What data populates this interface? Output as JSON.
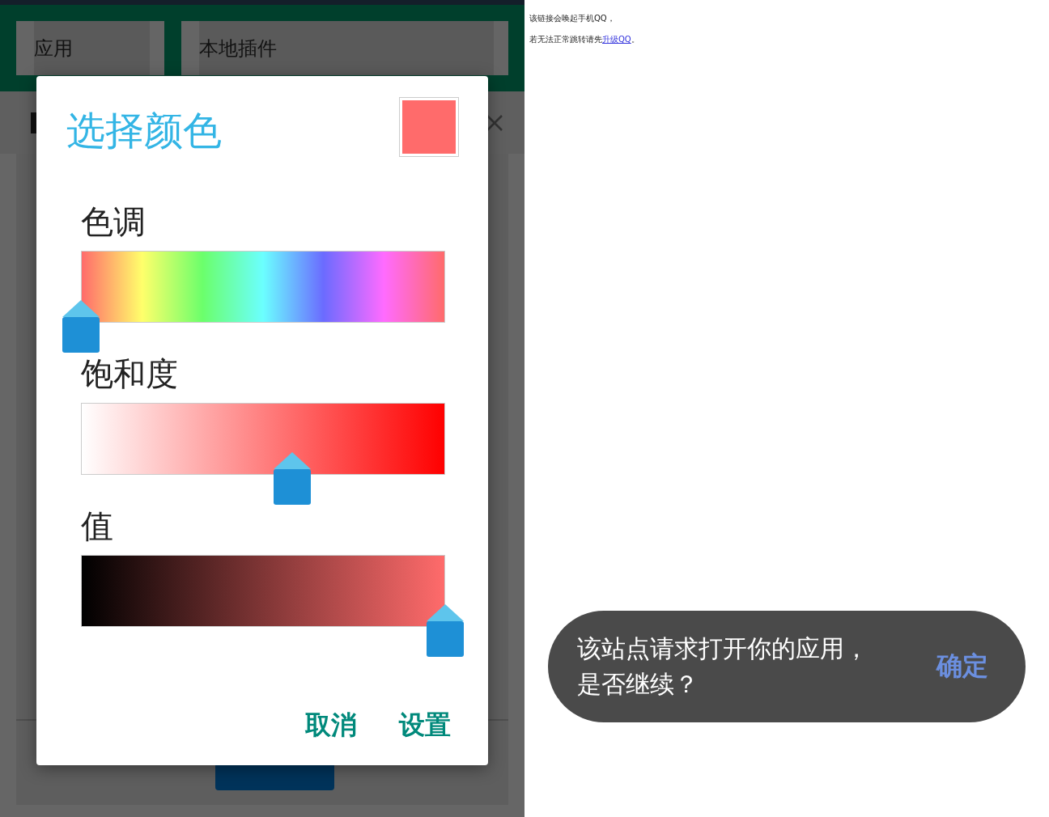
{
  "app": {
    "tabs": [
      {
        "label": "应用"
      },
      {
        "label": "本地插件"
      }
    ]
  },
  "color_dialog": {
    "title": "选择颜色",
    "swatch": {
      "color": "#ff6b6b"
    },
    "sliders": [
      {
        "label": "色调",
        "kind": "hue",
        "level": 0
      },
      {
        "label": "饱和度",
        "kind": "saturation",
        "level": 0.58
      },
      {
        "label": "值",
        "kind": "value",
        "level": 1
      }
    ],
    "buttons": [
      "取消",
      "设置"
    ]
  },
  "web_page": {
    "lines": [
      "该链接会唤起手机QQ，"
    ],
    "upgrade_line": {
      "text": "若无法正常跳转请先",
      "link": "升级QQ",
      "tail": "。"
    }
  },
  "toast": {
    "message": "该站点请求打开你的应用，是否继续？",
    "action": "确定"
  }
}
